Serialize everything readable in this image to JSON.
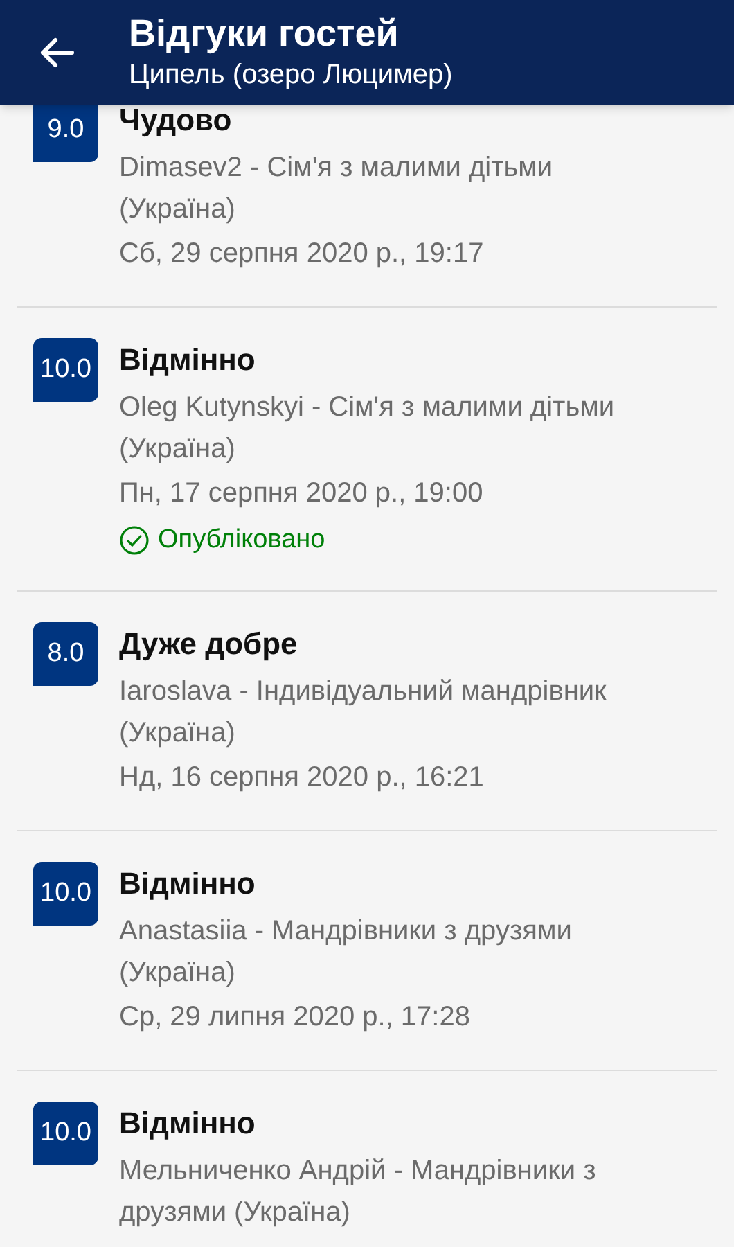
{
  "header": {
    "title": "Відгуки гостей",
    "subtitle": "Ципель (озеро Люцимер)"
  },
  "reviews": [
    {
      "score": "9.0",
      "verdict": "Чудово",
      "author": "Dimasev2 - Сім'я з малими дітьми (Україна)",
      "date": "Сб, 29 серпня 2020 р., 19:17",
      "published": false
    },
    {
      "score": "10.0",
      "verdict": "Відмінно",
      "author": "Oleg Kutynskyi - Сім'я з малими дітьми (Україна)",
      "date": "Пн, 17 серпня 2020 р., 19:00",
      "published": true,
      "status_text": "Опубліковано"
    },
    {
      "score": "8.0",
      "verdict": "Дуже добре",
      "author": "Iaroslava - Індивідуальний мандрівник (Україна)",
      "date": "Нд, 16 серпня 2020 р., 16:21",
      "published": false
    },
    {
      "score": "10.0",
      "verdict": "Відмінно",
      "author": "Anastasiia - Мандрівники з друзями (Україна)",
      "date": "Ср, 29 липня 2020 р., 17:28",
      "published": false
    },
    {
      "score": "10.0",
      "verdict": "Відмінно",
      "author": "Мельниченко Андрій - Мандрівники з друзями (Україна)",
      "published": false
    }
  ]
}
